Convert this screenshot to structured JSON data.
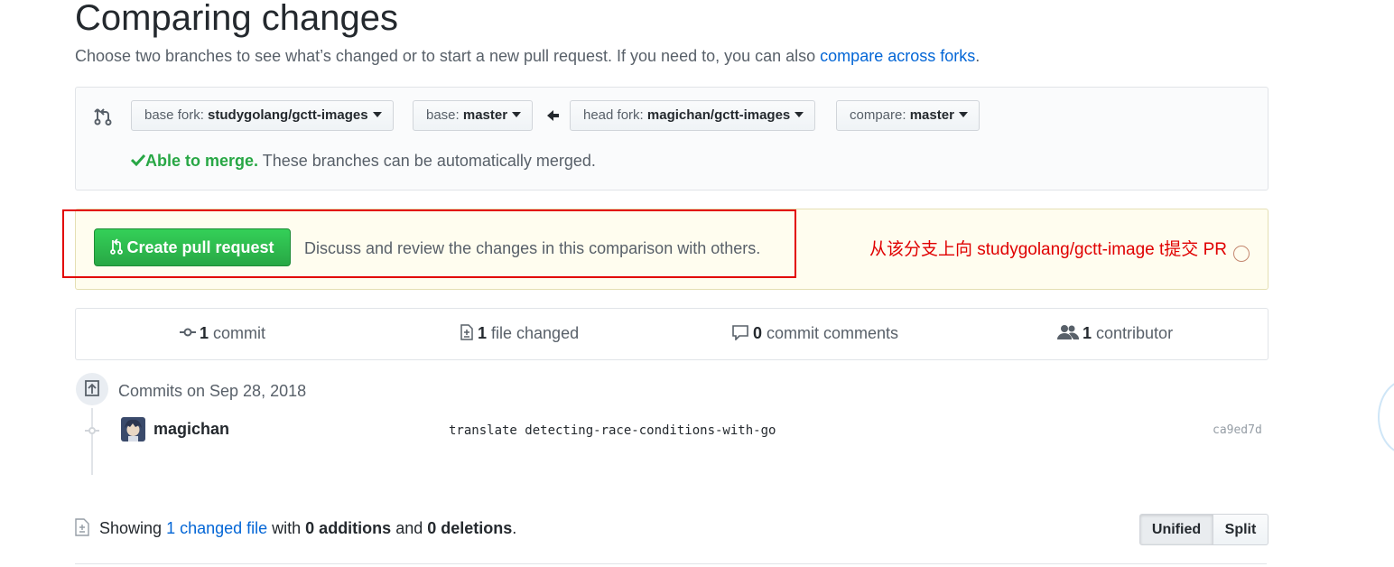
{
  "page": {
    "title": "Comparing changes",
    "subtitle_prefix": "Choose two branches to see what’s changed or to start a new pull request. If you need to, you can also ",
    "subtitle_link": "compare across forks",
    "subtitle_suffix": "."
  },
  "range": {
    "base_fork_label": "base fork: ",
    "base_fork_value": "studygolang/gctt-images",
    "base_label": "base: ",
    "base_value": "master",
    "head_fork_label": "head fork: ",
    "head_fork_value": "magichan/gctt-images",
    "compare_label": "compare: ",
    "compare_value": "master",
    "merge_ok": "Able to merge.",
    "merge_text": " These branches can be automatically merged.",
    "icons": {
      "swap": "git-compare-icon",
      "arrow": "arrow-left-icon",
      "check": "check-icon"
    }
  },
  "banner": {
    "button_label": "Create pull request",
    "description": "Discuss and review the changes in this comparison with others.",
    "annotation": "从该分支上向 studygolang/gctt-image t提交 PR"
  },
  "summary": {
    "commits_count": "1",
    "commits_label": " commit",
    "files_count": "1",
    "files_label": " file changed",
    "comments_count": "0",
    "comments_label": " commit comments",
    "contributors_count": "1",
    "contributors_label": " contributor"
  },
  "commits": {
    "date_heading": "Commits on Sep 28, 2018",
    "items": [
      {
        "author": "magichan",
        "message": "translate detecting-race-conditions-with-go",
        "sha": "ca9ed7d"
      }
    ]
  },
  "diff": {
    "showing": "Showing ",
    "changed_link": "1 changed file",
    "with": " with ",
    "additions": "0 additions",
    "and": " and ",
    "deletions": "0 deletions",
    "period": ".",
    "unified_label": "Unified",
    "split_label": "Split"
  },
  "colors": {
    "accent": "#0366d6",
    "success": "#28a745",
    "annotation": "#e00000",
    "banner_bg": "#fffdef"
  }
}
